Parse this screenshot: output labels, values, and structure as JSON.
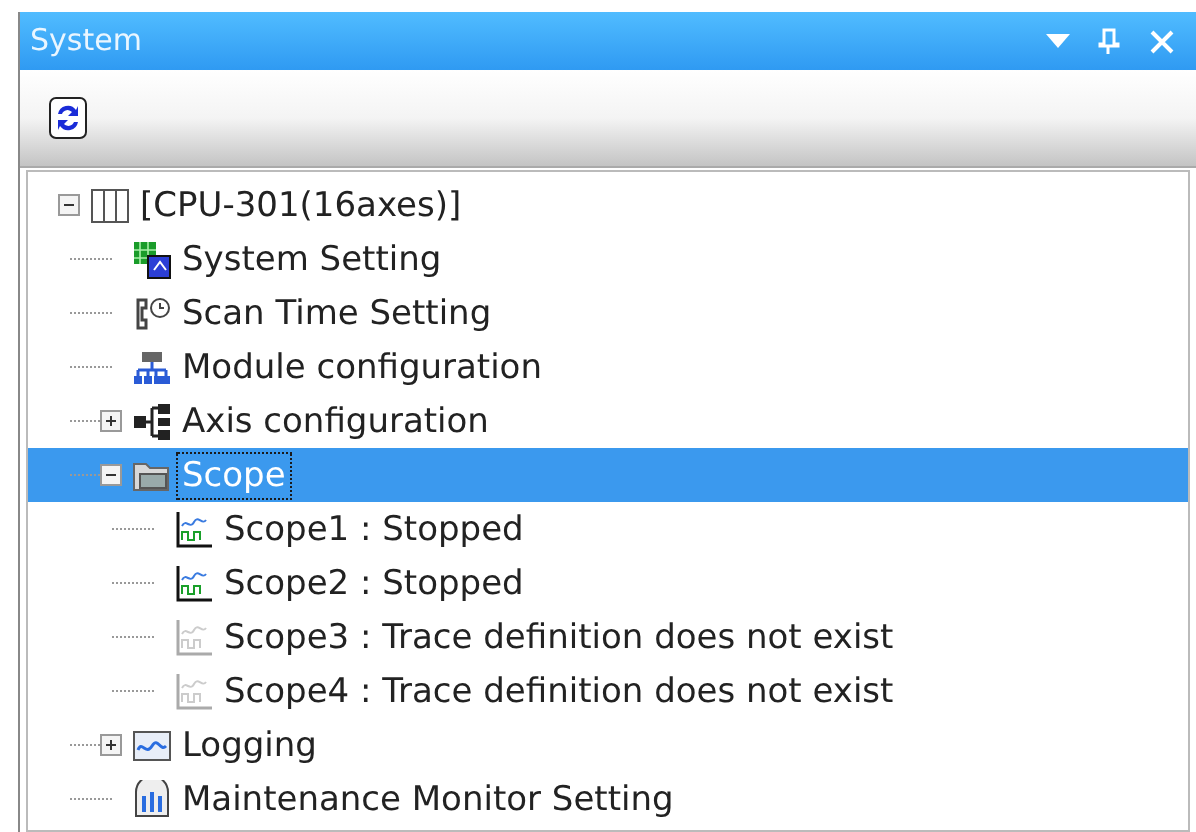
{
  "window": {
    "title": "System"
  },
  "tree": [
    {
      "label": "[CPU-301(16axes)]",
      "kind": "cpu",
      "expanded": true,
      "selected": false,
      "children": [
        {
          "label": "System Setting",
          "kind": "system",
          "selected": false
        },
        {
          "label": "Scan Time Setting",
          "kind": "scan",
          "selected": false
        },
        {
          "label": "Module configuration",
          "kind": "module",
          "selected": false
        },
        {
          "label": "Axis configuration",
          "kind": "axis",
          "expanded": false,
          "selected": false
        },
        {
          "label": "Scope",
          "kind": "folder",
          "expanded": true,
          "selected": true,
          "children": [
            {
              "label": "Scope1 : Stopped",
              "kind": "scope",
              "selected": false
            },
            {
              "label": "Scope2 : Stopped",
              "kind": "scope",
              "selected": false
            },
            {
              "label": "Scope3 : Trace definition does not exist",
              "kind": "scope-empty",
              "selected": false
            },
            {
              "label": "Scope4 : Trace definition does not exist",
              "kind": "scope-empty",
              "selected": false
            }
          ]
        },
        {
          "label": "Logging",
          "kind": "logging",
          "expanded": false,
          "selected": false
        },
        {
          "label": "Maintenance Monitor Setting",
          "kind": "maintenance",
          "selected": false
        }
      ]
    }
  ]
}
